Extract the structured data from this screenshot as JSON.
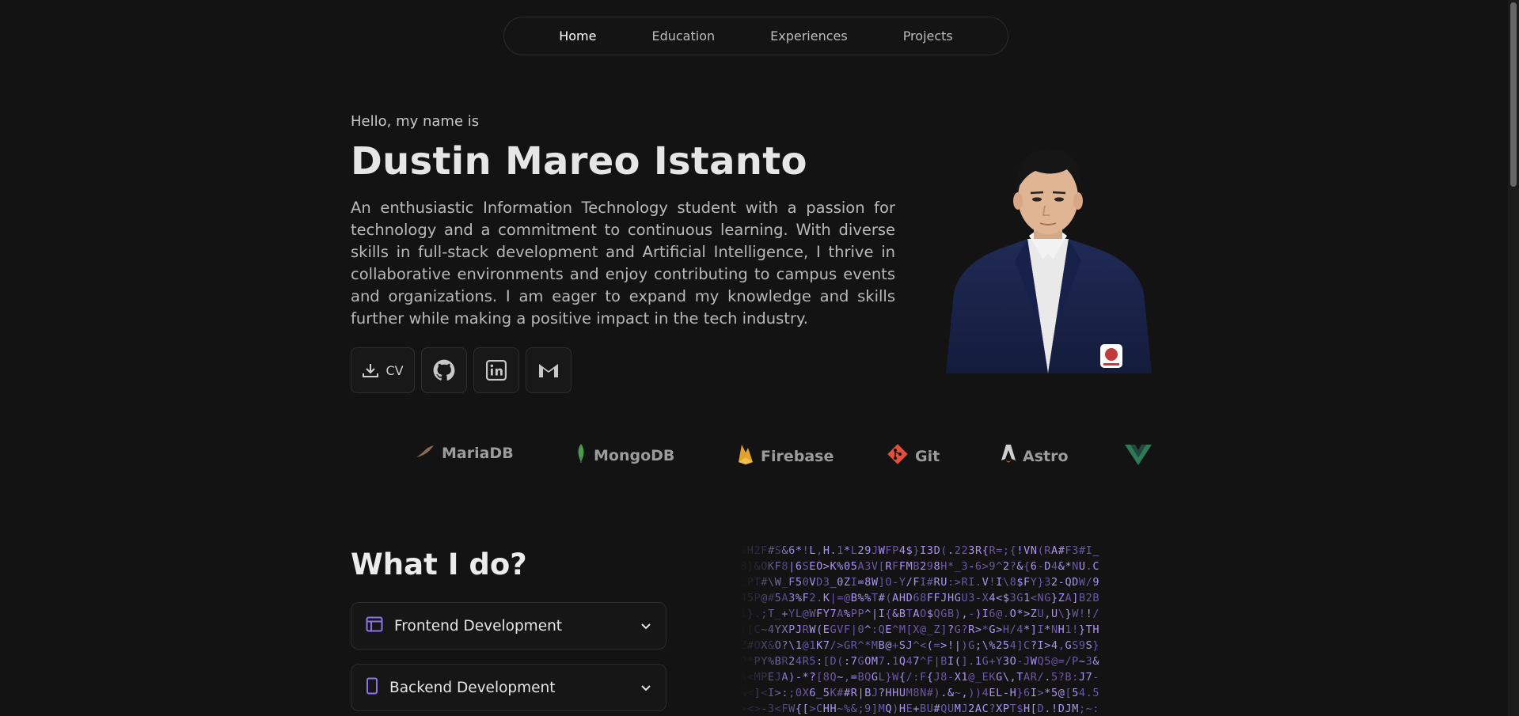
{
  "nav": {
    "items": [
      "Home",
      "Education",
      "Experiences",
      "Projects"
    ],
    "active": "Home"
  },
  "hero": {
    "greeting": "Hello, my name is",
    "name": "Dustin Mareo Istanto",
    "bio": "An enthusiastic Information Technology student with a passion for technology and a commitment to continuous learning. With diverse skills in full-stack development and Artificial Intelligence, I thrive in collaborative environments and enjoy contributing to campus events and organizations. I am eager to expand my knowledge and skills further while making a positive impact in the tech industry.",
    "cv_label": "CV",
    "links": [
      {
        "icon": "download-icon",
        "label": "CV"
      },
      {
        "icon": "github-icon"
      },
      {
        "icon": "linkedin-icon"
      },
      {
        "icon": "gmail-icon"
      }
    ]
  },
  "tech": [
    {
      "label": "MariaDB",
      "icon": "mariadb-icon",
      "color": "#8a6b55"
    },
    {
      "label": "MongoDB",
      "icon": "mongodb-icon",
      "color": "#4a9c4a"
    },
    {
      "label": "Firebase",
      "icon": "firebase-icon",
      "color": "#e3a32a"
    },
    {
      "label": "Git",
      "icon": "git-icon",
      "color": "#e0503a"
    },
    {
      "label": "Astro",
      "icon": "astro-icon",
      "color": "#cfcfcf"
    },
    {
      "label": "",
      "icon": "vue-icon",
      "color": "#2f7a56"
    }
  ],
  "services": {
    "heading": "What I do?",
    "items": [
      {
        "label": "Frontend Development",
        "icon": "browser-window-icon"
      },
      {
        "label": "Backend Development",
        "icon": "mobile-device-icon"
      }
    ]
  },
  "colors": {
    "accent": "#8b74e6",
    "background": "#131313"
  }
}
